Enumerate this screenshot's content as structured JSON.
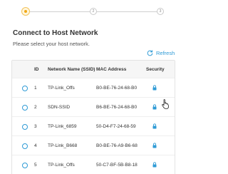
{
  "stepper": {
    "steps": [
      "",
      "2",
      "3"
    ],
    "accent": "#f0a818"
  },
  "header": {
    "title": "Connect to Host Network",
    "subtitle": "Please select your host network."
  },
  "refresh": {
    "label": "Refresh",
    "icon": "refresh-icon",
    "color": "#2f9bd6"
  },
  "table": {
    "columns": [
      "ID",
      "Network Name (SSID)",
      "MAC Address",
      "Security"
    ],
    "rows": [
      {
        "id": "1",
        "ssid": "TP-Link_Offs",
        "mac": "B0-BE-76-24-68-B0",
        "security_icon": "lock-icon"
      },
      {
        "id": "2",
        "ssid": "SDN-SSID",
        "mac": "B6-BE-76-24-68-B0",
        "security_icon": "lock-icon"
      },
      {
        "id": "3",
        "ssid": "TP-Link_6859",
        "mac": "50-D4-F7-24-68-59",
        "security_icon": "lock-icon"
      },
      {
        "id": "4",
        "ssid": "TP-Link_B668",
        "mac": "B0-BE-76-A9-B6-68",
        "security_icon": "lock-icon"
      },
      {
        "id": "5",
        "ssid": "TP-Link_Offs",
        "mac": "50-C7-BF-5B-B8-18",
        "security_icon": "lock-icon"
      }
    ]
  }
}
